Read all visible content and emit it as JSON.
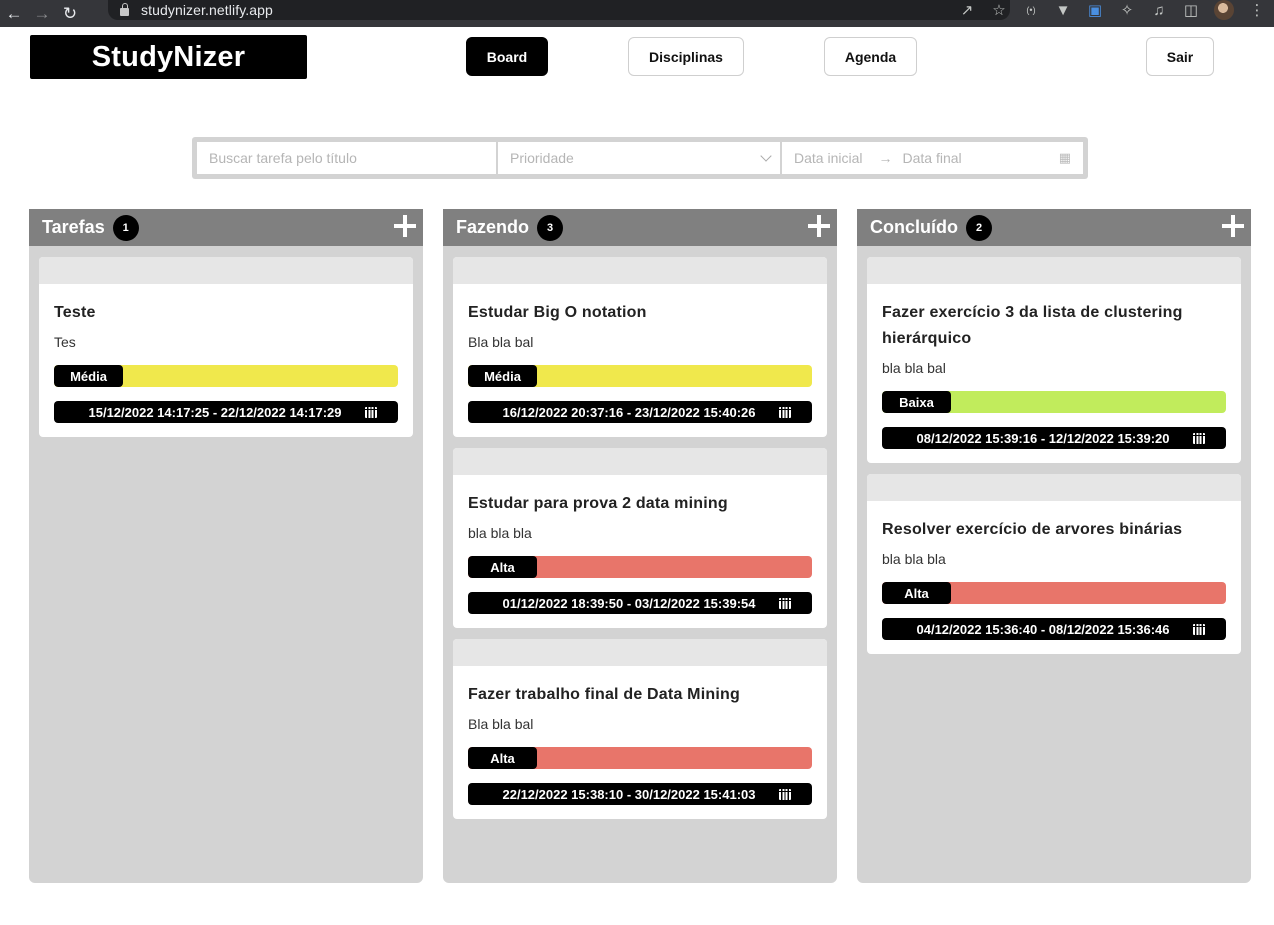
{
  "browser": {
    "url": "studynizer.netlify.app"
  },
  "app": {
    "logo": "StudyNizer"
  },
  "nav": {
    "board": "Board",
    "disciplinas": "Disciplinas",
    "agenda": "Agenda",
    "sair": "Sair"
  },
  "filters": {
    "search_placeholder": "Buscar tarefa pelo título",
    "priority_placeholder": "Prioridade",
    "date_start_placeholder": "Data inicial",
    "date_end_placeholder": "Data final"
  },
  "colors": {
    "media": "#f0e84c",
    "alta": "#e8756a",
    "baixa": "#c1ec5c"
  },
  "columns": [
    {
      "title": "Tarefas",
      "count": "1",
      "cards": [
        {
          "title": "Teste",
          "description": "Tes",
          "priority": "Média",
          "priority_color": "#f0e84c",
          "dates": "15/12/2022 14:17:25 - 22/12/2022 14:17:29"
        }
      ]
    },
    {
      "title": "Fazendo",
      "count": "3",
      "cards": [
        {
          "title": "Estudar Big O notation",
          "description": "Bla bla bal",
          "priority": "Média",
          "priority_color": "#f0e84c",
          "dates": "16/12/2022 20:37:16 - 23/12/2022 15:40:26"
        },
        {
          "title": "Estudar para prova 2 data mining",
          "description": "bla bla bla",
          "priority": "Alta",
          "priority_color": "#e8756a",
          "dates": "01/12/2022 18:39:50 - 03/12/2022 15:39:54"
        },
        {
          "title": "Fazer trabalho final de Data Mining",
          "description": "Bla bla bal",
          "priority": "Alta",
          "priority_color": "#e8756a",
          "dates": "22/12/2022 15:38:10 - 30/12/2022 15:41:03"
        }
      ]
    },
    {
      "title": "Concluído",
      "count": "2",
      "cards": [
        {
          "title": "Fazer exercício 3 da lista de clustering hierárquico",
          "description": "bla bla bal",
          "priority": "Baixa",
          "priority_color": "#c1ec5c",
          "dates": "08/12/2022 15:39:16 - 12/12/2022 15:39:20"
        },
        {
          "title": "Resolver exercício de arvores binárias",
          "description": "bla bla bla",
          "priority": "Alta",
          "priority_color": "#e8756a",
          "dates": "04/12/2022 15:36:40 - 08/12/2022 15:36:46"
        }
      ]
    }
  ]
}
